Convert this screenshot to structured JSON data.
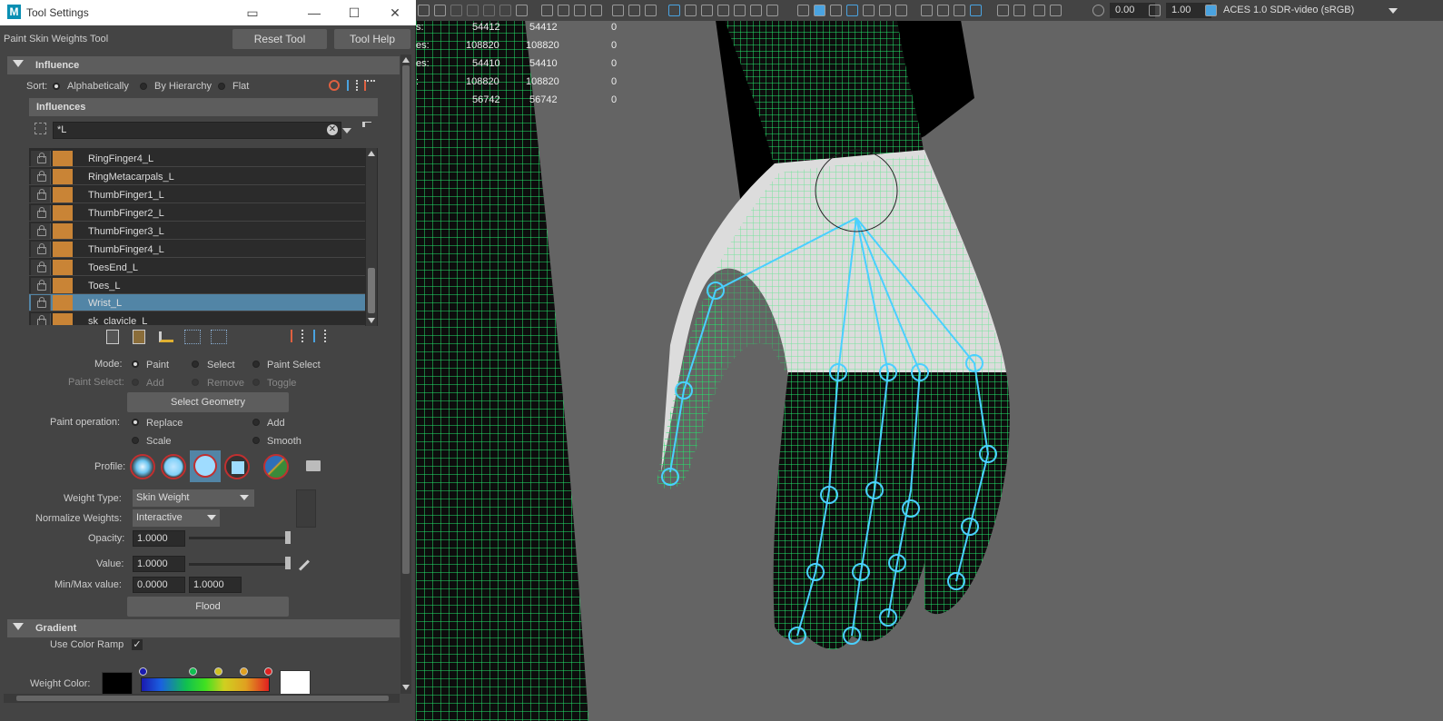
{
  "window": {
    "title": "Tool Settings",
    "minimize": "—",
    "maximize": "☐",
    "close": "✕"
  },
  "tool": {
    "name": "Paint Skin Weights Tool",
    "reset_label": "Reset Tool",
    "help_label": "Tool Help"
  },
  "influence": {
    "section_label": "Influence",
    "sort_label": "Sort:",
    "sort_options": [
      "Alphabetically",
      "By Hierarchy",
      "Flat"
    ],
    "influences_header": "Influences",
    "filter_value": "*L",
    "items": [
      "RingFinger4_L",
      "RingMetacarpals_L",
      "ThumbFinger1_L",
      "ThumbFinger2_L",
      "ThumbFinger3_L",
      "ThumbFinger4_L",
      "ToesEnd_L",
      "Toes_L",
      "Wrist_L",
      "sk_clavicle_L"
    ],
    "selected": "Wrist_L"
  },
  "mode": {
    "label": "Mode:",
    "options": [
      "Paint",
      "Select",
      "Paint Select"
    ]
  },
  "paint_select": {
    "label": "Paint Select:",
    "options": [
      "Add",
      "Remove",
      "Toggle"
    ]
  },
  "select_geometry_label": "Select Geometry",
  "paint_operation": {
    "label": "Paint operation:",
    "options": [
      "Replace",
      "Add",
      "Scale",
      "Smooth"
    ]
  },
  "profile_label": "Profile:",
  "weight_type": {
    "label": "Weight Type:",
    "value": "Skin Weight"
  },
  "normalize": {
    "label": "Normalize Weights:",
    "value": "Interactive"
  },
  "opacity": {
    "label": "Opacity:",
    "value": "1.0000",
    "level": 1.0
  },
  "value": {
    "label": "Value:",
    "value": "1.0000",
    "level": 1.0
  },
  "minmax": {
    "label": "Min/Max value:",
    "min": "0.0000",
    "max": "1.0000"
  },
  "flood_label": "Flood",
  "gradient": {
    "section_label": "Gradient",
    "use_ramp_label": "Use Color Ramp",
    "weight_color_label": "Weight Color:"
  },
  "viewport": {
    "exposure": "0.00",
    "gamma": "1.00",
    "colorspace": "ACES 1.0 SDR-video (sRGB)",
    "stats": [
      {
        "label": "s:",
        "a": "54412",
        "b": "54412",
        "c": "0"
      },
      {
        "label": "es:",
        "a": "108820",
        "b": "108820",
        "c": "0"
      },
      {
        "label": "es:",
        "a": "54410",
        "b": "54410",
        "c": "0"
      },
      {
        "label": ":",
        "a": "108820",
        "b": "108820",
        "c": "0"
      },
      {
        "label": "",
        "a": "56742",
        "b": "56742",
        "c": "0"
      }
    ]
  },
  "colors": {
    "swatch": "#c98436",
    "selected": "#5285a6",
    "wire": "#22e86a",
    "joint": "#4ad0ff"
  }
}
